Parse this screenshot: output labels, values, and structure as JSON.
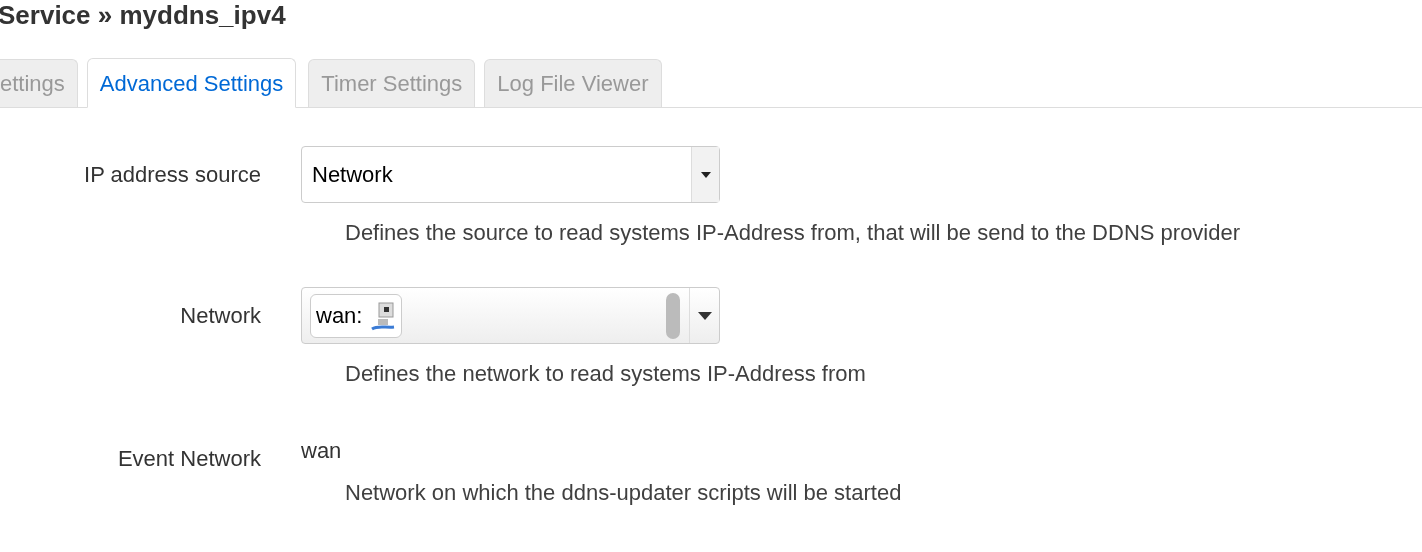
{
  "title": "Service » myddns_ipv4",
  "tabs": [
    {
      "label": "ettings",
      "selected": false
    },
    {
      "label": "Advanced Settings",
      "selected": true
    },
    {
      "label": "Timer Settings",
      "selected": false
    },
    {
      "label": "Log File Viewer",
      "selected": false
    }
  ],
  "fields": [
    {
      "kind": "select",
      "label": "IP address source",
      "value": "Network",
      "description": "Defines the source to read systems IP-Address from, that will be send to the DDNS provider"
    },
    {
      "kind": "multiselect",
      "label": "Network",
      "value": "wan:",
      "description": "Defines the network to read systems IP-Address from"
    },
    {
      "kind": "text",
      "label": "Event Network",
      "value": "wan",
      "description": "Network on which the ddns-updater scripts will be started"
    }
  ]
}
